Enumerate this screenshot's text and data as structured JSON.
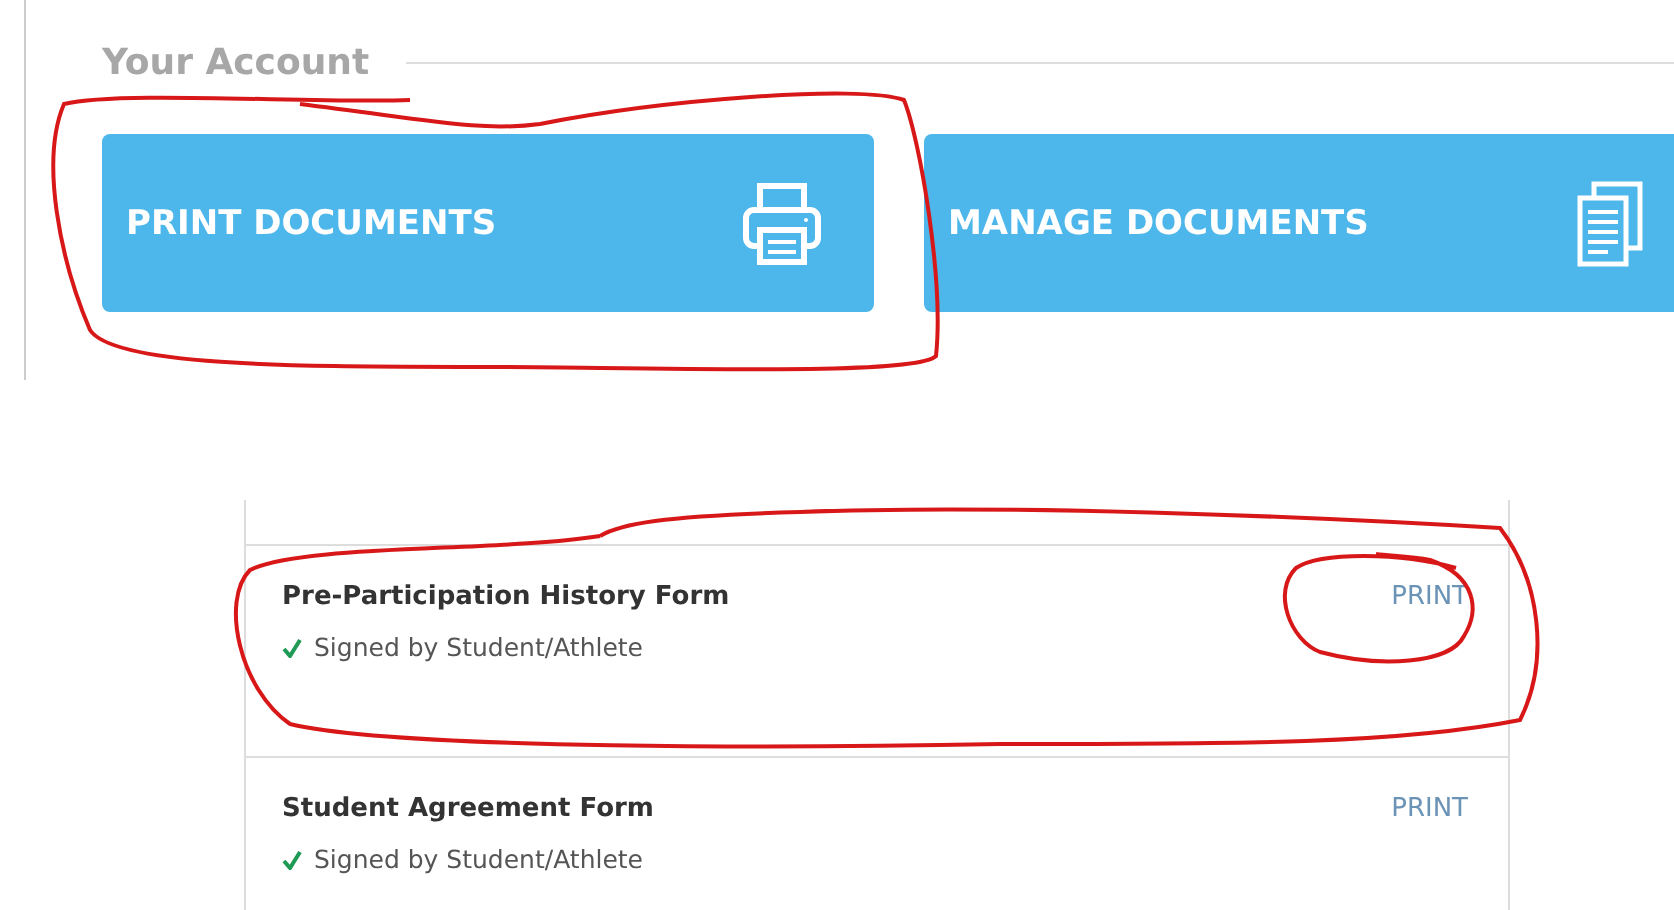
{
  "section": {
    "title": "Your Account"
  },
  "tiles": [
    {
      "label": "PRINT DOCUMENTS",
      "kind": "printer"
    },
    {
      "label": "MANAGE DOCUMENTS",
      "kind": "documents"
    }
  ],
  "documents": [
    {
      "name": "Pre-Participation History Form",
      "status": "Signed by Student/Athlete",
      "signed": true,
      "action": "PRINT"
    },
    {
      "name": "Student Agreement Form",
      "status": "Signed by Student/Athlete",
      "signed": true,
      "action": "PRINT"
    }
  ]
}
